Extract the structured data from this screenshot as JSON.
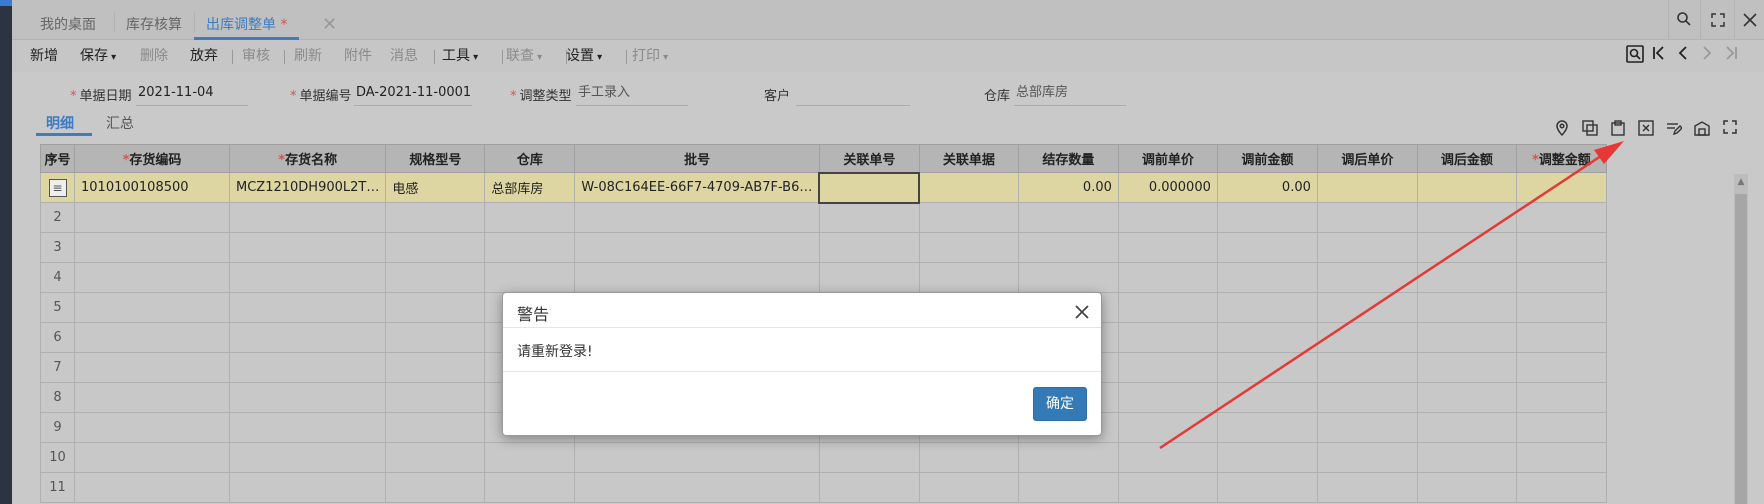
{
  "tabs": [
    {
      "label": "我的桌面"
    },
    {
      "label": "库存核算"
    },
    {
      "label": "出库调整单",
      "modified": "*"
    }
  ],
  "tab_close_glyph": "✕",
  "window_buttons": [
    "search-icon",
    "fullscreen-icon",
    "close-icon"
  ],
  "toolbar": {
    "new": "新增",
    "save": "保存",
    "delete": "删除",
    "discard": "放弃",
    "audit": "审核",
    "refresh": "刷新",
    "attach": "附件",
    "message": "消息",
    "tools": "工具",
    "link": "联查",
    "settings": "设置",
    "print": "打印"
  },
  "form": {
    "date_label": "单据日期",
    "date_value": "2021-11-04",
    "no_label": "单据编号",
    "no_value": "DA-2021-11-0001",
    "type_label": "调整类型",
    "type_value": "手工录入",
    "customer_label": "客户",
    "customer_value": "",
    "warehouse_label": "仓库",
    "warehouse_value": "总部库房"
  },
  "subtabs": {
    "detail": "明细",
    "summary": "汇总"
  },
  "grid": {
    "headers": [
      "序号",
      "存货编码",
      "存货名称",
      "规格型号",
      "仓库",
      "批号",
      "关联单号",
      "关联单据",
      "结存数量",
      "调前单价",
      "调前金额",
      "调后单价",
      "调后金额",
      "调整金额"
    ],
    "required": [
      false,
      true,
      true,
      false,
      false,
      false,
      false,
      false,
      false,
      false,
      false,
      false,
      false,
      true
    ],
    "rows": [
      [
        "",
        "1010100108500",
        "MCZ1210DH900L2T…",
        "电感",
        "总部库房",
        "W-08C164EE-66F7-4709-AB7F-B6…",
        "",
        "",
        "0.00",
        "0.000000",
        "0.00",
        "",
        "",
        ""
      ],
      [
        "2",
        "",
        "",
        "",
        "",
        "",
        "",
        "",
        "",
        "",
        "",
        "",
        "",
        ""
      ],
      [
        "3",
        "",
        "",
        "",
        "",
        "",
        "",
        "",
        "",
        "",
        "",
        "",
        "",
        ""
      ],
      [
        "4",
        "",
        "",
        "",
        "",
        "",
        "",
        "",
        "",
        "",
        "",
        "",
        "",
        ""
      ],
      [
        "5",
        "",
        "",
        "",
        "",
        "",
        "",
        "",
        "",
        "",
        "",
        "",
        "",
        ""
      ],
      [
        "6",
        "",
        "",
        "",
        "",
        "",
        "",
        "",
        "",
        "",
        "",
        "",
        "",
        ""
      ],
      [
        "7",
        "",
        "",
        "",
        "",
        "",
        "",
        "",
        "",
        "",
        "",
        "",
        "",
        ""
      ],
      [
        "8",
        "",
        "",
        "",
        "",
        "",
        "",
        "",
        "",
        "",
        "",
        "",
        "",
        ""
      ],
      [
        "9",
        "",
        "",
        "",
        "",
        "",
        "",
        "",
        "",
        "",
        "",
        "",
        "",
        ""
      ],
      [
        "10",
        "",
        "",
        "",
        "",
        "",
        "",
        "",
        "",
        "",
        "",
        "",
        "",
        ""
      ],
      [
        "11",
        "",
        "",
        "",
        "",
        "",
        "",
        "",
        "",
        "",
        "",
        "",
        "",
        ""
      ]
    ]
  },
  "dialog": {
    "title": "警告",
    "message": "请重新登录!",
    "ok": "确定"
  },
  "colors": {
    "accent": "#3b7cc2",
    "required": "#d9534f",
    "selected_row": "#ddd6a3",
    "primary_button": "#337ab7",
    "annotation": "#e53935"
  }
}
